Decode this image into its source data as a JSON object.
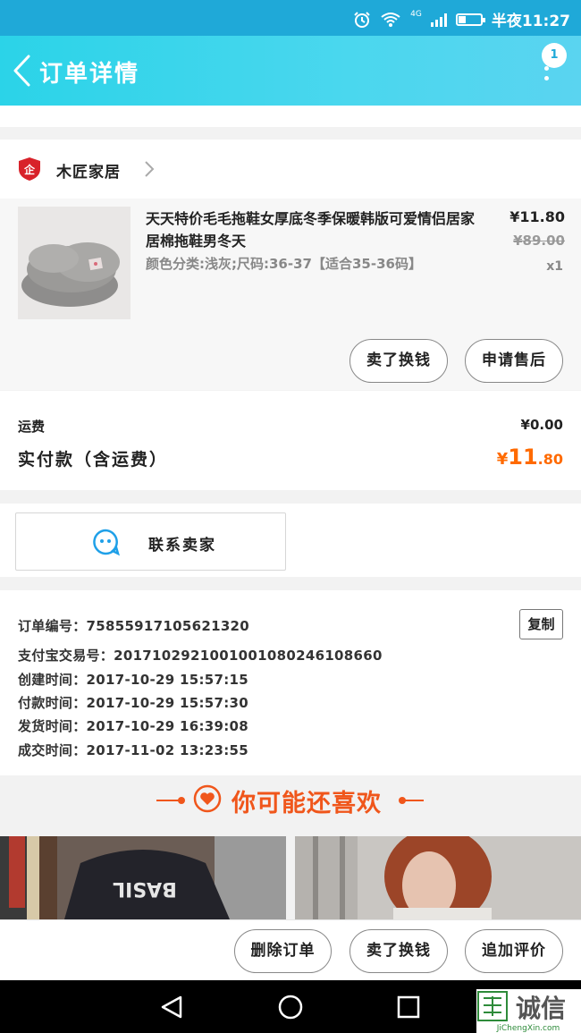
{
  "status_bar": {
    "time": "半夜11:27",
    "network": "4G"
  },
  "header": {
    "title": "订单详情",
    "badge_count": "1"
  },
  "shop": {
    "name": "木匠家居",
    "logo_text": "企"
  },
  "item": {
    "title": "天天特价毛毛拖鞋女厚底冬季保暖韩版可爱情侣居家居棉拖鞋男冬天",
    "spec": "颜色分类:浅灰;尺码:36-37【适合35-36码】",
    "price": "¥11.80",
    "original_price": "¥89.00",
    "quantity": "x1",
    "actions": {
      "sell_button": "卖了换钱",
      "after_sale_button": "申请售后"
    }
  },
  "fees": {
    "shipping_label": "运费",
    "shipping_value": "¥0.00",
    "paid_label": "实付款（含运费）",
    "paid_symbol": "¥",
    "paid_integer": "11",
    "paid_decimal": ".80"
  },
  "contact": {
    "label": "联系卖家"
  },
  "order_info": {
    "order_no": "订单编号：75855917105621320",
    "alipay_no": "支付宝交易号：2017102921001001080246108660",
    "created": "创建时间：2017-10-29 15:57:15",
    "paid": "付款时间：2017-10-29 15:57:30",
    "shipped": "发货时间：2017-10-29 16:39:08",
    "completed": "成交时间：2017-11-02 13:23:55",
    "copy_button": "复制"
  },
  "recommend": {
    "title": "你可能还喜欢",
    "photo1_text": "BASIL"
  },
  "bottom_actions": {
    "delete": "删除订单",
    "sell": "卖了换钱",
    "review": "追加评价"
  },
  "watermark": {
    "logo": "诚信",
    "sub": "JiChengXin.com"
  },
  "colors": {
    "header_start": "#2bd3e8",
    "accent_orange": "#ff6a00",
    "recommend": "#f0561b"
  }
}
